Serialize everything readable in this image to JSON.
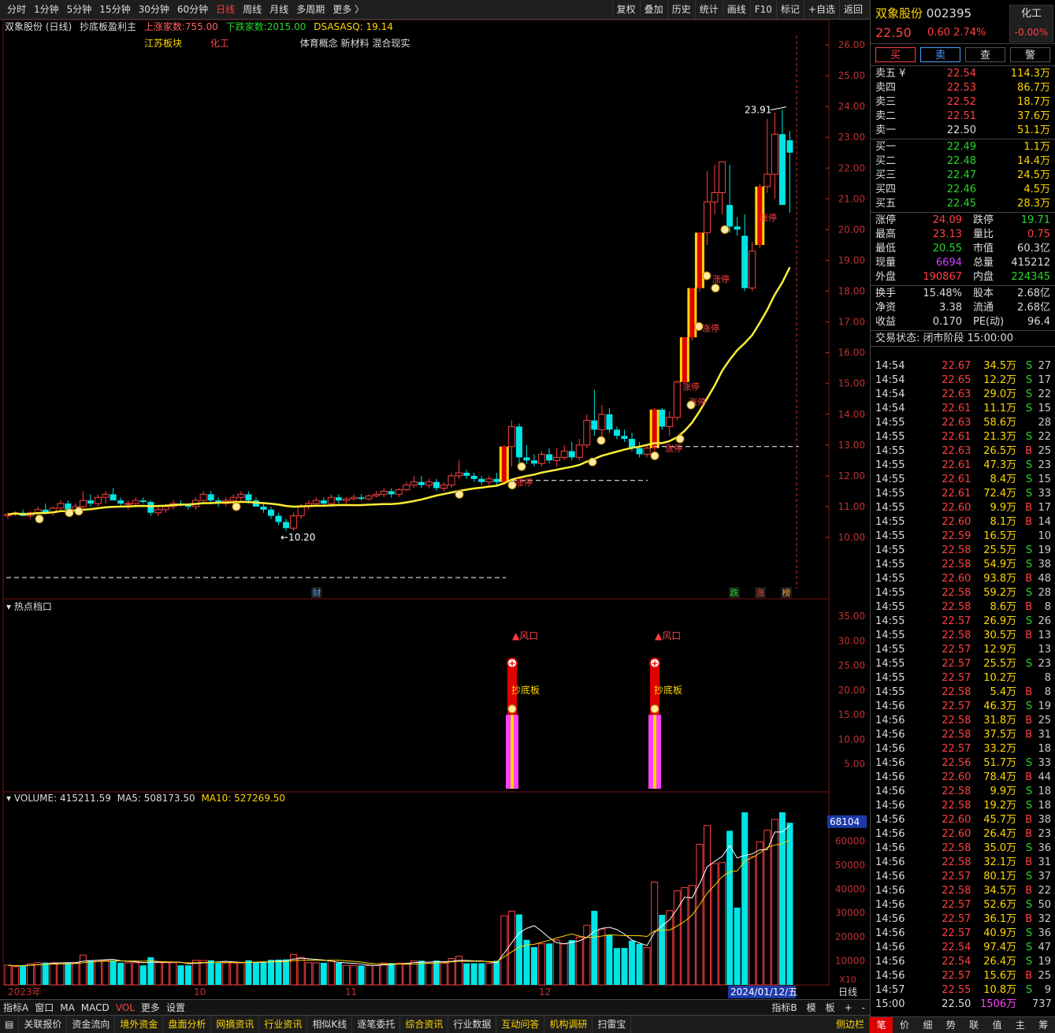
{
  "toolbar": {
    "periods": [
      "分时",
      "1分钟",
      "5分钟",
      "15分钟",
      "30分钟",
      "60分钟",
      "日线",
      "周线",
      "月线",
      "多周期",
      "更多 〉"
    ],
    "active": "日线",
    "tools": [
      "复权",
      "叠加",
      "历史",
      "统计",
      "画线",
      "F10",
      "标记",
      "+自选",
      "返回"
    ]
  },
  "info": {
    "title": "双象股份 (日线)",
    "indicator": "抄底板盈利主",
    "up_label": "上涨家数:",
    "up_val": "755.00",
    "down_label": "下跌家数:",
    "down_val": "2015.00",
    "dsa_label": "DSASASQ:",
    "dsa_val": "19.14",
    "sector1": "江苏板块",
    "sector2": "化工",
    "concepts": "体育概念 新材料 混合现实"
  },
  "main_axis": [
    "26.00",
    "25.00",
    "24.00",
    "23.00",
    "22.00",
    "21.00",
    "20.00",
    "19.00",
    "18.00",
    "17.00",
    "16.00",
    "15.00",
    "14.00",
    "13.00",
    "12.00",
    "11.00",
    "10.00"
  ],
  "annotations": {
    "high": "23.91",
    "low": "←10.20",
    "markers": [
      "财",
      "跌",
      "涨",
      "榜"
    ],
    "limit": "涨停"
  },
  "hot": {
    "title": "热点档口",
    "axis": [
      "35.00",
      "30.00",
      "25.00",
      "20.00",
      "15.00",
      "10.00",
      "5.00"
    ],
    "label_wind": "▲风口",
    "label_bottom": "抄底板"
  },
  "vol": {
    "title": "VOLUME: 415211.59",
    "ma5": "MA5: 508173.50",
    "ma10": "MA10: 527269.50",
    "axis": [
      "60000",
      "50000",
      "40000",
      "30000",
      "20000",
      "10000"
    ],
    "top_tag": "68104",
    "unit": "X10"
  },
  "dates": {
    "year": "2023年",
    "m10": "10",
    "m11": "11",
    "m12": "12",
    "cur": "2024/01/12/五",
    "period": "日线"
  },
  "tabs": {
    "items": [
      "指标A",
      "窗口",
      "MA",
      "MACD",
      "VOL",
      "更多",
      "设置"
    ],
    "active": "VOL",
    "right": [
      "指标B",
      "模",
      "板",
      "+",
      "-"
    ]
  },
  "bottom": {
    "items": [
      "关联报价",
      "资金流向",
      "境外资金",
      "盘面分析",
      "网摘资讯",
      "行业资讯",
      "相似K线",
      "逐笔委托",
      "综合资讯",
      "行业数据",
      "互动问答",
      "机构调研",
      "扫雷宝"
    ],
    "gold": [
      "境外资金",
      "盘面分析",
      "网摘资讯",
      "行业资讯",
      "综合资讯",
      "互动问答",
      "机构调研"
    ],
    "side": "侧边栏"
  },
  "quote": {
    "name": "双象股份",
    "code": "002395",
    "price": "22.50",
    "chg": "0.60",
    "pct": "2.74%",
    "ind_name": "化工",
    "ind_pct": "-0.00%",
    "buttons": [
      "买",
      "卖",
      "查",
      "警"
    ],
    "sells": [
      [
        "卖五 ¥",
        "22.54",
        "114.3万"
      ],
      [
        "卖四",
        "22.53",
        "86.7万"
      ],
      [
        "卖三",
        "22.52",
        "18.7万"
      ],
      [
        "卖二",
        "22.51",
        "37.6万"
      ],
      [
        "卖一",
        "22.50",
        "51.1万"
      ]
    ],
    "buys": [
      [
        "买一",
        "22.49",
        "1.1万"
      ],
      [
        "买二",
        "22.48",
        "14.4万"
      ],
      [
        "买三",
        "22.47",
        "24.5万"
      ],
      [
        "买四",
        "22.46",
        "4.5万"
      ],
      [
        "买五",
        "22.45",
        "28.3万"
      ]
    ],
    "stats": [
      [
        "涨停",
        "24.09",
        "跌停",
        "19.71"
      ],
      [
        "最高",
        "23.13",
        "量比",
        "0.75"
      ],
      [
        "最低",
        "20.55",
        "市值",
        "60.3亿"
      ],
      [
        "现量",
        "6694",
        "总量",
        "415212"
      ],
      [
        "外盘",
        "190867",
        "内盘",
        "224345"
      ]
    ],
    "stats2": [
      [
        "换手",
        "15.48%",
        "股本",
        "2.68亿"
      ],
      [
        "净资",
        "3.38",
        "流通",
        "2.68亿"
      ],
      [
        "收益",
        "0.170",
        "PE(动)",
        "96.4"
      ]
    ],
    "state": "交易状态: 闭市阶段 15:00:00"
  },
  "ticks": [
    [
      "14:54",
      "22.67",
      "34.5万",
      "S",
      "27"
    ],
    [
      "14:54",
      "22.65",
      "12.2万",
      "S",
      "17"
    ],
    [
      "14:54",
      "22.63",
      "29.0万",
      "S",
      "22"
    ],
    [
      "14:54",
      "22.61",
      "11.1万",
      "S",
      "15"
    ],
    [
      "14:55",
      "22.63",
      "58.6万",
      "",
      "28"
    ],
    [
      "14:55",
      "22.61",
      "21.3万",
      "S",
      "22"
    ],
    [
      "14:55",
      "22.63",
      "26.5万",
      "B",
      "25"
    ],
    [
      "14:55",
      "22.61",
      "47.3万",
      "S",
      "23"
    ],
    [
      "14:55",
      "22.61",
      "8.4万",
      "S",
      "15"
    ],
    [
      "14:55",
      "22.61",
      "72.4万",
      "S",
      "33"
    ],
    [
      "14:55",
      "22.60",
      "9.9万",
      "B",
      "17"
    ],
    [
      "14:55",
      "22.60",
      "8.1万",
      "B",
      "14"
    ],
    [
      "14:55",
      "22.59",
      "16.5万",
      "",
      "10"
    ],
    [
      "14:55",
      "22.58",
      "25.5万",
      "S",
      "19"
    ],
    [
      "14:55",
      "22.58",
      "54.9万",
      "S",
      "38"
    ],
    [
      "14:55",
      "22.60",
      "93.8万",
      "B",
      "48"
    ],
    [
      "14:55",
      "22.58",
      "59.2万",
      "S",
      "28"
    ],
    [
      "14:55",
      "22.58",
      "8.6万",
      "B",
      "8"
    ],
    [
      "14:55",
      "22.57",
      "26.9万",
      "S",
      "26"
    ],
    [
      "14:55",
      "22.58",
      "30.5万",
      "B",
      "13"
    ],
    [
      "14:55",
      "22.57",
      "12.9万",
      "",
      "13"
    ],
    [
      "14:55",
      "22.57",
      "25.5万",
      "S",
      "23"
    ],
    [
      "14:55",
      "22.57",
      "10.2万",
      "",
      "8"
    ],
    [
      "14:55",
      "22.58",
      "5.4万",
      "B",
      "8"
    ],
    [
      "14:56",
      "22.57",
      "46.3万",
      "S",
      "19"
    ],
    [
      "14:56",
      "22.58",
      "31.8万",
      "B",
      "25"
    ],
    [
      "14:56",
      "22.58",
      "37.5万",
      "B",
      "31"
    ],
    [
      "14:56",
      "22.57",
      "33.2万",
      "",
      "18"
    ],
    [
      "14:56",
      "22.56",
      "51.7万",
      "S",
      "33"
    ],
    [
      "14:56",
      "22.60",
      "78.4万",
      "B",
      "44"
    ],
    [
      "14:56",
      "22.58",
      "9.9万",
      "S",
      "18"
    ],
    [
      "14:56",
      "22.58",
      "19.2万",
      "S",
      "18"
    ],
    [
      "14:56",
      "22.60",
      "45.7万",
      "B",
      "38"
    ],
    [
      "14:56",
      "22.60",
      "26.4万",
      "B",
      "23"
    ],
    [
      "14:56",
      "22.58",
      "35.0万",
      "S",
      "36"
    ],
    [
      "14:56",
      "22.58",
      "32.1万",
      "B",
      "31"
    ],
    [
      "14:56",
      "22.57",
      "80.1万",
      "S",
      "37"
    ],
    [
      "14:56",
      "22.58",
      "34.5万",
      "B",
      "22"
    ],
    [
      "14:56",
      "22.57",
      "52.6万",
      "S",
      "50"
    ],
    [
      "14:56",
      "22.57",
      "36.1万",
      "B",
      "32"
    ],
    [
      "14:56",
      "22.57",
      "40.9万",
      "S",
      "36"
    ],
    [
      "14:56",
      "22.54",
      "97.4万",
      "S",
      "47"
    ],
    [
      "14:56",
      "22.54",
      "26.4万",
      "S",
      "19"
    ],
    [
      "14:56",
      "22.57",
      "15.6万",
      "B",
      "25"
    ],
    [
      "14:57",
      "22.55",
      "10.8万",
      "S",
      "9"
    ],
    [
      "15:00",
      "22.50",
      "1506万",
      "",
      "737"
    ]
  ],
  "right_tabs": [
    "笔",
    "价",
    "细",
    "势",
    "联",
    "值",
    "主",
    "筹"
  ],
  "chart_data": {
    "type": "candlestick",
    "ohlc": [
      [
        10.7,
        10.8,
        10.6,
        10.75
      ],
      [
        10.75,
        10.85,
        10.7,
        10.8
      ],
      [
        10.8,
        10.9,
        10.7,
        10.7
      ],
      [
        10.7,
        10.85,
        10.6,
        10.8
      ],
      [
        10.8,
        11.0,
        10.7,
        10.9
      ],
      [
        10.9,
        11.1,
        10.8,
        10.8
      ],
      [
        10.8,
        11.0,
        10.7,
        10.95
      ],
      [
        10.95,
        11.2,
        10.9,
        11.1
      ],
      [
        11.1,
        11.2,
        10.9,
        10.9
      ],
      [
        10.9,
        11.1,
        10.8,
        11.0
      ],
      [
        11.0,
        11.5,
        10.9,
        11.2
      ],
      [
        11.2,
        11.4,
        11.0,
        11.1
      ],
      [
        11.1,
        11.4,
        11.0,
        11.3
      ],
      [
        11.3,
        11.5,
        11.1,
        11.4
      ],
      [
        11.4,
        11.6,
        11.2,
        11.2
      ],
      [
        11.2,
        11.3,
        11.0,
        11.1
      ],
      [
        11.1,
        11.2,
        10.9,
        11.1
      ],
      [
        11.1,
        11.3,
        11.0,
        11.2
      ],
      [
        11.2,
        11.3,
        11.1,
        11.15
      ],
      [
        11.15,
        11.2,
        10.7,
        10.8
      ],
      [
        10.8,
        11.0,
        10.7,
        10.9
      ],
      [
        10.9,
        11.1,
        10.8,
        11.0
      ],
      [
        11.0,
        11.2,
        10.9,
        11.1
      ],
      [
        11.1,
        11.2,
        11.0,
        11.05
      ],
      [
        11.05,
        11.1,
        10.9,
        11.0
      ],
      [
        11.0,
        11.3,
        10.9,
        11.2
      ],
      [
        11.2,
        11.5,
        11.1,
        11.4
      ],
      [
        11.4,
        11.5,
        11.1,
        11.2
      ],
      [
        11.2,
        11.3,
        11.0,
        11.1
      ],
      [
        11.1,
        11.3,
        11.0,
        11.2
      ],
      [
        11.2,
        11.4,
        11.1,
        11.3
      ],
      [
        11.3,
        11.5,
        11.2,
        11.4
      ],
      [
        11.4,
        11.5,
        11.1,
        11.2
      ],
      [
        11.2,
        11.3,
        11.0,
        11.0
      ],
      [
        11.0,
        11.1,
        10.8,
        10.9
      ],
      [
        10.9,
        11.0,
        10.6,
        10.7
      ],
      [
        10.7,
        10.8,
        10.4,
        10.5
      ],
      [
        10.5,
        10.6,
        10.2,
        10.3
      ],
      [
        10.3,
        10.8,
        10.2,
        10.7
      ],
      [
        10.7,
        11.1,
        10.6,
        11.0
      ],
      [
        11.0,
        11.2,
        10.9,
        11.1
      ],
      [
        11.1,
        11.3,
        11.0,
        11.2
      ],
      [
        11.2,
        11.3,
        11.0,
        11.1
      ],
      [
        11.1,
        11.4,
        11.0,
        11.3
      ],
      [
        11.3,
        11.4,
        11.1,
        11.2
      ],
      [
        11.2,
        11.3,
        11.1,
        11.25
      ],
      [
        11.25,
        11.4,
        11.2,
        11.3
      ],
      [
        11.3,
        11.4,
        11.2,
        11.25
      ],
      [
        11.25,
        11.4,
        11.2,
        11.35
      ],
      [
        11.35,
        11.5,
        11.3,
        11.4
      ],
      [
        11.4,
        11.6,
        11.3,
        11.5
      ],
      [
        11.5,
        11.6,
        11.3,
        11.4
      ],
      [
        11.4,
        11.6,
        11.3,
        11.55
      ],
      [
        11.55,
        11.8,
        11.5,
        11.7
      ],
      [
        11.7,
        12.0,
        11.6,
        11.8
      ],
      [
        11.8,
        12.0,
        11.6,
        11.7
      ],
      [
        11.7,
        11.9,
        11.6,
        11.8
      ],
      [
        11.8,
        11.9,
        11.5,
        11.6
      ],
      [
        11.6,
        11.8,
        11.5,
        11.7
      ],
      [
        11.7,
        12.1,
        11.6,
        12.0
      ],
      [
        12.0,
        12.5,
        11.9,
        12.1
      ],
      [
        12.1,
        12.2,
        11.9,
        12.0
      ],
      [
        12.0,
        12.1,
        11.8,
        11.9
      ],
      [
        11.9,
        12.0,
        11.7,
        11.8
      ],
      [
        11.8,
        12.0,
        11.7,
        11.9
      ],
      [
        11.9,
        12.1,
        11.7,
        11.8
      ],
      [
        11.8,
        13.0,
        11.7,
        12.95
      ],
      [
        12.95,
        13.8,
        12.3,
        13.6
      ],
      [
        13.6,
        13.7,
        12.4,
        12.6
      ],
      [
        12.6,
        13.0,
        12.4,
        12.5
      ],
      [
        12.5,
        12.7,
        12.3,
        12.4
      ],
      [
        12.4,
        12.8,
        12.3,
        12.7
      ],
      [
        12.7,
        12.9,
        12.4,
        12.5
      ],
      [
        12.5,
        12.9,
        12.3,
        12.6
      ],
      [
        12.6,
        13.0,
        12.5,
        12.8
      ],
      [
        12.8,
        13.1,
        12.5,
        12.6
      ],
      [
        12.6,
        13.2,
        12.5,
        13.0
      ],
      [
        13.0,
        14.0,
        12.9,
        13.8
      ],
      [
        13.8,
        14.8,
        13.3,
        13.5
      ],
      [
        13.5,
        14.3,
        13.3,
        14.0
      ],
      [
        14.0,
        14.2,
        13.4,
        13.5
      ],
      [
        13.5,
        13.6,
        13.2,
        13.3
      ],
      [
        13.3,
        13.5,
        13.1,
        13.2
      ],
      [
        13.2,
        13.4,
        12.8,
        12.9
      ],
      [
        12.9,
        13.1,
        12.6,
        12.7
      ],
      [
        12.7,
        13.0,
        12.6,
        12.9
      ],
      [
        12.9,
        14.2,
        12.8,
        14.15
      ],
      [
        14.15,
        14.2,
        13.5,
        13.6
      ],
      [
        13.6,
        14.1,
        13.3,
        13.9
      ],
      [
        13.9,
        15.1,
        13.8,
        15.05
      ],
      [
        15.05,
        16.5,
        15.0,
        16.5
      ],
      [
        16.5,
        18.1,
        16.4,
        18.1
      ],
      [
        18.1,
        19.9,
        18.0,
        19.9
      ],
      [
        19.9,
        21.9,
        19.5,
        20.9
      ],
      [
        20.9,
        22.1,
        20.5,
        21.2
      ],
      [
        21.2,
        22.2,
        20.5,
        22.2
      ],
      [
        20.8,
        22.1,
        19.9,
        20.1
      ],
      [
        20.1,
        20.4,
        19.8,
        20.0
      ],
      [
        19.8,
        20.5,
        18.0,
        18.1
      ],
      [
        18.1,
        19.6,
        18.0,
        19.3
      ],
      [
        19.5,
        21.5,
        19.4,
        21.4
      ],
      [
        21.4,
        23.6,
        21.2,
        21.8
      ],
      [
        21.8,
        23.8,
        21.0,
        23.1
      ],
      [
        23.1,
        23.9,
        21.0,
        20.8
      ],
      [
        22.9,
        23.2,
        20.55,
        22.5
      ]
    ]
  }
}
